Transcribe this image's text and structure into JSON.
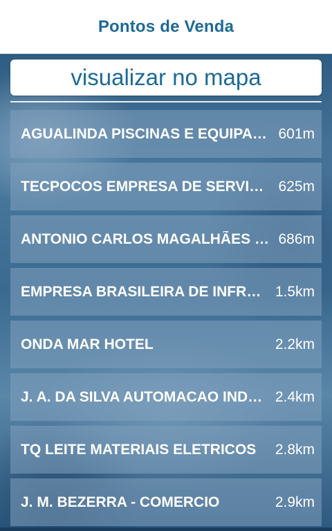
{
  "header": {
    "title": "Pontos de Venda"
  },
  "map_button": {
    "label": "visualizar no mapa"
  },
  "stores": [
    {
      "name": "AGUALINDA PISCINAS E EQUIPAMENTOS",
      "distance": "601m"
    },
    {
      "name": "TECPOCOS EMPRESA DE SERVICOS",
      "distance": "625m"
    },
    {
      "name": "ANTONIO CARLOS MAGALHÃES DA SILVA",
      "distance": "686m"
    },
    {
      "name": "EMPRESA BRASILEIRA DE INFRAESTRUTURA",
      "distance": "1.5km"
    },
    {
      "name": "ONDA MAR HOTEL",
      "distance": "2.2km"
    },
    {
      "name": "J. A. DA SILVA AUTOMACAO INDUSTRIAL",
      "distance": "2.4km"
    },
    {
      "name": "TQ LEITE MATERIAIS ELETRICOS",
      "distance": "2.8km"
    },
    {
      "name": "J. M. BEZERRA - COMERCIO",
      "distance": "2.9km"
    }
  ],
  "colors": {
    "accent": "#1c6a96",
    "header_bg": "#ffffff",
    "item_text": "#ffffff"
  }
}
